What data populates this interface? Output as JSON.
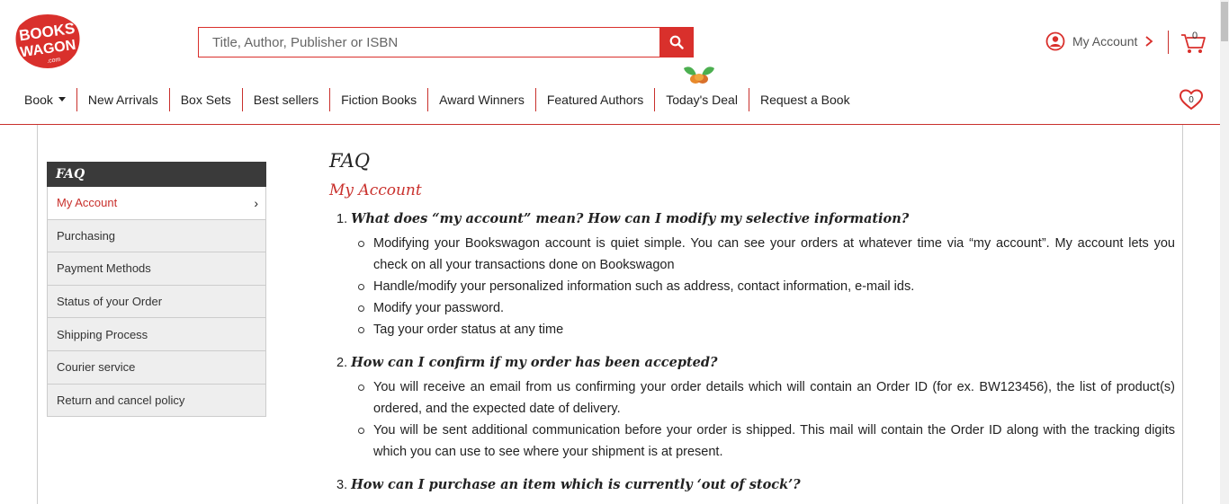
{
  "header": {
    "logo_text": "BOOKS WAGON .com",
    "search": {
      "placeholder": "Title, Author, Publisher or ISBN",
      "value": ""
    },
    "account_label": "My Account",
    "cart_count": "0",
    "wishlist_count": "0"
  },
  "nav": {
    "items": [
      {
        "label": "Book"
      },
      {
        "label": "New Arrivals"
      },
      {
        "label": "Box Sets"
      },
      {
        "label": "Best sellers"
      },
      {
        "label": "Fiction Books"
      },
      {
        "label": "Award Winners"
      },
      {
        "label": "Featured Authors"
      },
      {
        "label": "Today's Deal"
      },
      {
        "label": "Request a Book"
      }
    ]
  },
  "sidebar": {
    "title": "FAQ",
    "items": [
      {
        "label": "My Account",
        "active": true
      },
      {
        "label": "Purchasing"
      },
      {
        "label": "Payment Methods"
      },
      {
        "label": "Status of your Order"
      },
      {
        "label": "Shipping Process"
      },
      {
        "label": "Courier service"
      },
      {
        "label": "Return and cancel policy"
      }
    ]
  },
  "main": {
    "title": "FAQ",
    "section_title": "My Account",
    "questions": [
      {
        "number": "1.",
        "title": "What does “my account” mean? How can I modify my selective information?",
        "answers": [
          "Modifying your Bookswagon account is quiet simple. You can see your orders at whatever time via “my account”. My account lets you check on all your transactions done on Bookswagon",
          "Handle/modify your personalized information such as address, contact information, e-mail ids.",
          "Modify your password.",
          "Tag your order status at any time"
        ]
      },
      {
        "number": "2.",
        "title": "How can I confirm if my order has been accepted?",
        "answers": [
          "You will receive an email from us confirming your order details which will contain an Order ID (for ex. BW123456), the list of product(s) ordered, and the expected date of delivery.",
          "You will be sent additional communication before your order is shipped. This mail will contain the Order ID along with the tracking digits which you can use to see where your shipment is at present."
        ]
      },
      {
        "number": "3.",
        "title": "How can I purchase an item which is currently ‘out of stock’?",
        "answers": []
      }
    ]
  },
  "colors": {
    "brand": "#d9302c",
    "sidebar_head": "#3a3a3a"
  }
}
